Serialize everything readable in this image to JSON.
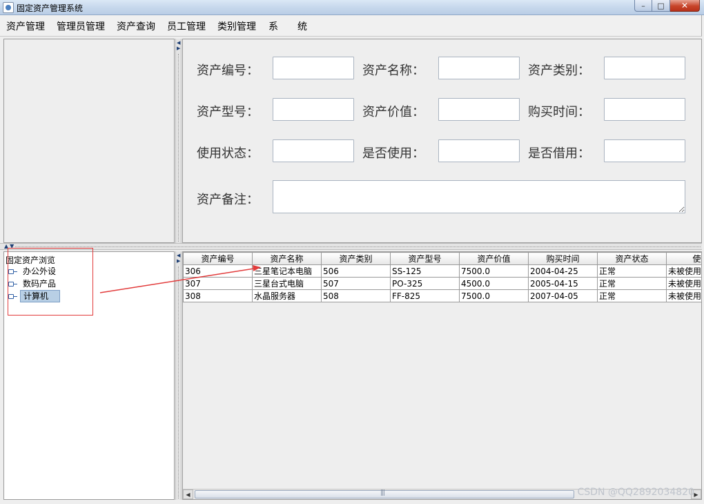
{
  "window": {
    "title": "固定资产管理系统",
    "controls": {
      "minimize": "–",
      "maximize": "□",
      "close": "✕"
    }
  },
  "menu": [
    "资产管理",
    "管理员管理",
    "资产查询",
    "员工管理",
    "类别管理",
    "系　　统"
  ],
  "form": {
    "fields": [
      {
        "label": "资产编号：",
        "value": ""
      },
      {
        "label": "资产名称：",
        "value": ""
      },
      {
        "label": "资产类别：",
        "value": ""
      },
      {
        "label": "资产型号：",
        "value": ""
      },
      {
        "label": "资产价值：",
        "value": ""
      },
      {
        "label": "购买时间：",
        "value": ""
      },
      {
        "label": "使用状态：",
        "value": ""
      },
      {
        "label": "是否使用：",
        "value": ""
      },
      {
        "label": "是否借用：",
        "value": ""
      }
    ],
    "remark_label": "资产备注："
  },
  "tree": {
    "root": "固定资产浏览",
    "nodes": [
      "办公外设",
      "数码产品",
      "计算机"
    ],
    "selected_index": 2
  },
  "table": {
    "columns": [
      "资产编号",
      "资产名称",
      "资产类别",
      "资产型号",
      "资产价值",
      "购买时间",
      "资产状态",
      "使用"
    ],
    "rows": [
      [
        "306",
        "三星笔记本电脑",
        "506",
        "SS-125",
        "7500.0",
        "2004-04-25",
        "正常",
        "未被使用"
      ],
      [
        "307",
        "三星台式电脑",
        "507",
        "PO-325",
        "4500.0",
        "2005-04-15",
        "正常",
        "未被使用"
      ],
      [
        "308",
        "水晶服务器",
        "508",
        "FF-825",
        "7500.0",
        "2007-04-05",
        "正常",
        "未被使用"
      ]
    ]
  },
  "watermark": "CSDN @QQ2892034820",
  "colors": {
    "annotation": "#e23b3b",
    "selection": "#b8cfe5"
  },
  "icons": {
    "window": "app-icon",
    "tree_node": "tree-handle-icon",
    "scroll_left": "arrow-left-icon",
    "scroll_right": "arrow-right-icon"
  }
}
